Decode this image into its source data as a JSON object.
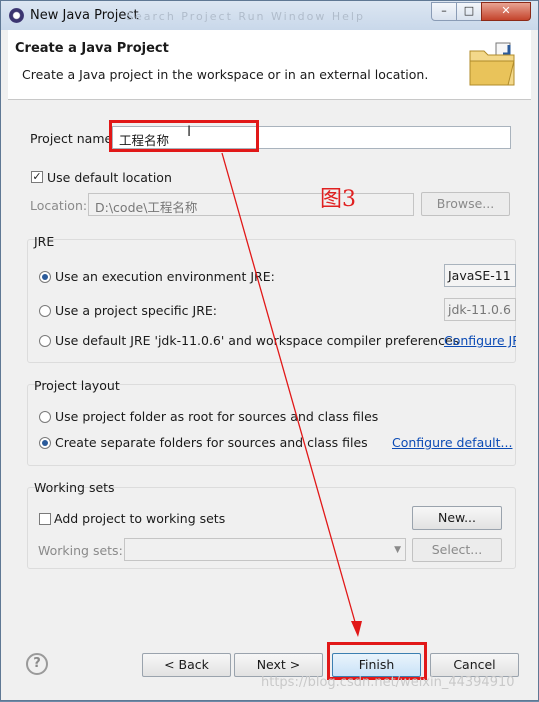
{
  "window": {
    "title": "New Java Project",
    "ghost_menu": "Search  Project  Run  Window  Help"
  },
  "header": {
    "title": "Create a Java Project",
    "description": "Create a Java project in the workspace or in an external location."
  },
  "project": {
    "name_label": "Project name:",
    "name_value": "工程名称",
    "use_default_label": "Use default location",
    "use_default_checked": true,
    "location_label": "Location:",
    "location_value": "D:\\code\\工程名称",
    "browse_label": "Browse..."
  },
  "annotation": {
    "figure_label": "图3"
  },
  "jre": {
    "group_label": "JRE",
    "opt_env": "Use an execution environment JRE:",
    "opt_env_value": "JavaSE-11",
    "opt_specific": "Use a project specific JRE:",
    "opt_specific_value": "jdk-11.0.6",
    "opt_default": "Use default JRE 'jdk-11.0.6' and workspace compiler preferences",
    "configure_link": "Configure JRE"
  },
  "layout": {
    "group_label": "Project layout",
    "opt_root": "Use project folder as root for sources and class files",
    "opt_separate": "Create separate folders for sources and class files",
    "configure_link": "Configure default..."
  },
  "working_sets": {
    "group_label": "Working sets",
    "add_label": "Add project to working sets",
    "new_label": "New...",
    "sets_label": "Working sets:",
    "select_label": "Select..."
  },
  "footer": {
    "back_label": "< Back",
    "next_label": "Next >",
    "finish_label": "Finish",
    "cancel_label": "Cancel",
    "watermark": "https://blog.csdn.net/weixin_44394910"
  }
}
